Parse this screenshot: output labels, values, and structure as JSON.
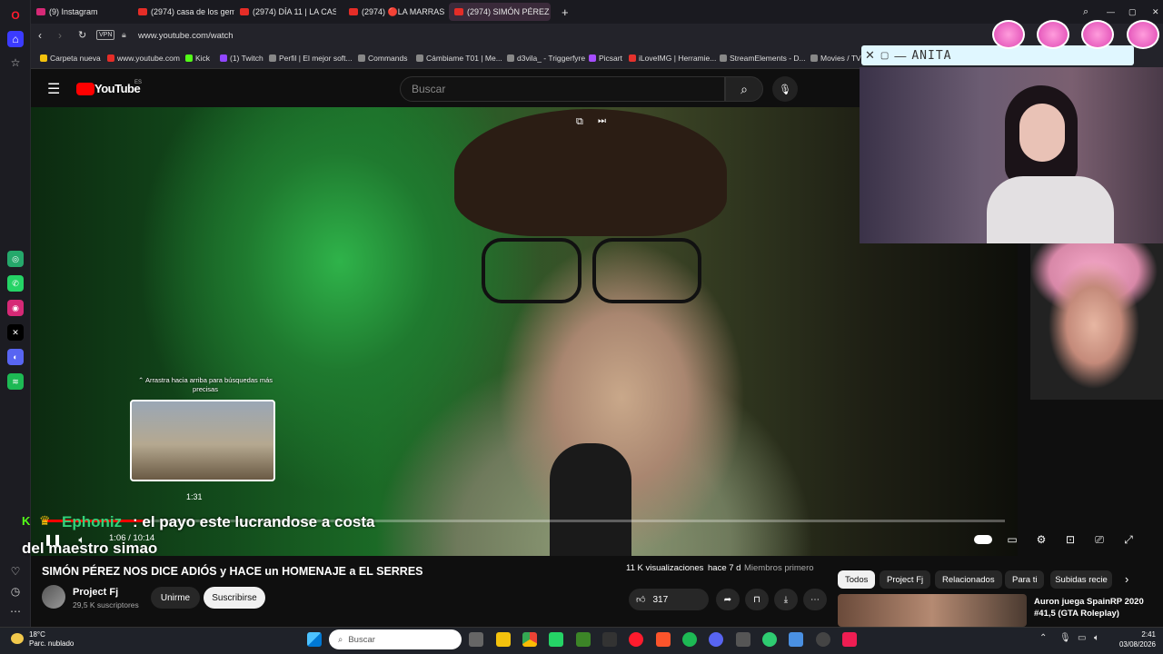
{
  "browser": {
    "tabs": [
      {
        "label": "(9) Instagram"
      },
      {
        "label": "(2974) casa de los gemelo"
      },
      {
        "label": "(2974) DÍA 11 | LA CASA D"
      },
      {
        "label": "(2974) 🔴LA MARRASH y"
      },
      {
        "label": "(2974) SIMÓN PÉREZ"
      }
    ],
    "vpn_badge": "VPN",
    "url": "www.youtube.com/watch",
    "bookmarks": [
      "Carpeta nueva",
      "www.youtube.com",
      "Kick",
      "(1) Twitch",
      "Perfil | El mejor soft...",
      "Commands",
      "Cámbiame T01 | Me...",
      "d3vila_ - Triggerfyre",
      "Picsart",
      "iLoveIMG | Herramie...",
      "StreamElements - D...",
      "Movies / TV"
    ]
  },
  "youtube": {
    "logo": "YouTube",
    "region": "ES",
    "search_placeholder": "Buscar",
    "preview_hint": "⌃ Arrastra hacia arriba para búsquedas más precisas",
    "preview_time": "1:31",
    "time_display": "1:06 / 10:14",
    "progress": 0.106,
    "video_title": "SIMÓN PÉREZ NOS DICE ADIÓS y HACE un HOMENAJE a EL SERRES",
    "views": "11 K visualizaciones",
    "date": "hace 7 d",
    "members": "Miembros primero",
    "channel": {
      "name": "Project Fj",
      "subs": "29,5 K suscriptores"
    },
    "join_label": "Unirme",
    "subscribe_label": "Suscribirse",
    "likes": "317",
    "chips": [
      "Todos",
      "Project Fj",
      "Relacionados",
      "Para ti",
      "Subidas recie"
    ],
    "rec_title": "Auron juega SpainRP 2020 #41,5 (GTA Roleplay)"
  },
  "chat": {
    "name": "Ephoniz",
    "msg_line1": ": el payo este lucrandose a costa",
    "msg_line2": "del maestro simao"
  },
  "overlay": {
    "title": "ANITA"
  },
  "taskbar": {
    "temp": "18°C",
    "weather": "Parc. nublado",
    "search": "Buscar",
    "time": "2:41",
    "date": "03/08/2026"
  },
  "colors": {
    "accent": "#ff0000",
    "chat_name": "#33d17a"
  }
}
